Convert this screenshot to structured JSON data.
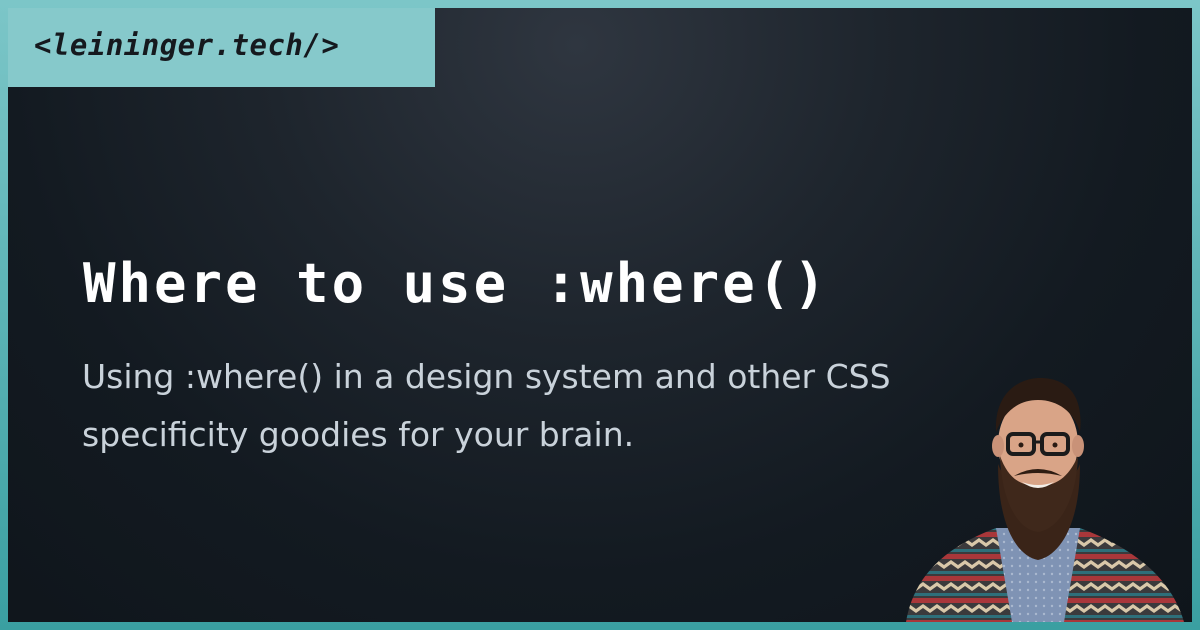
{
  "brand": {
    "text": "<leininger.tech/>"
  },
  "post": {
    "title": "Where to use :where()",
    "subtitle_line1": "Using :where() in a design system and other CSS",
    "subtitle_line2": "specificity goodies for your brain."
  },
  "colors": {
    "frame": "#5fb9bb",
    "brand_tab": "#86c9cb",
    "background": "#151c23",
    "title": "#ffffff",
    "subtitle": "#c9d2da"
  },
  "icons": {
    "author_photo": "author-portrait"
  }
}
